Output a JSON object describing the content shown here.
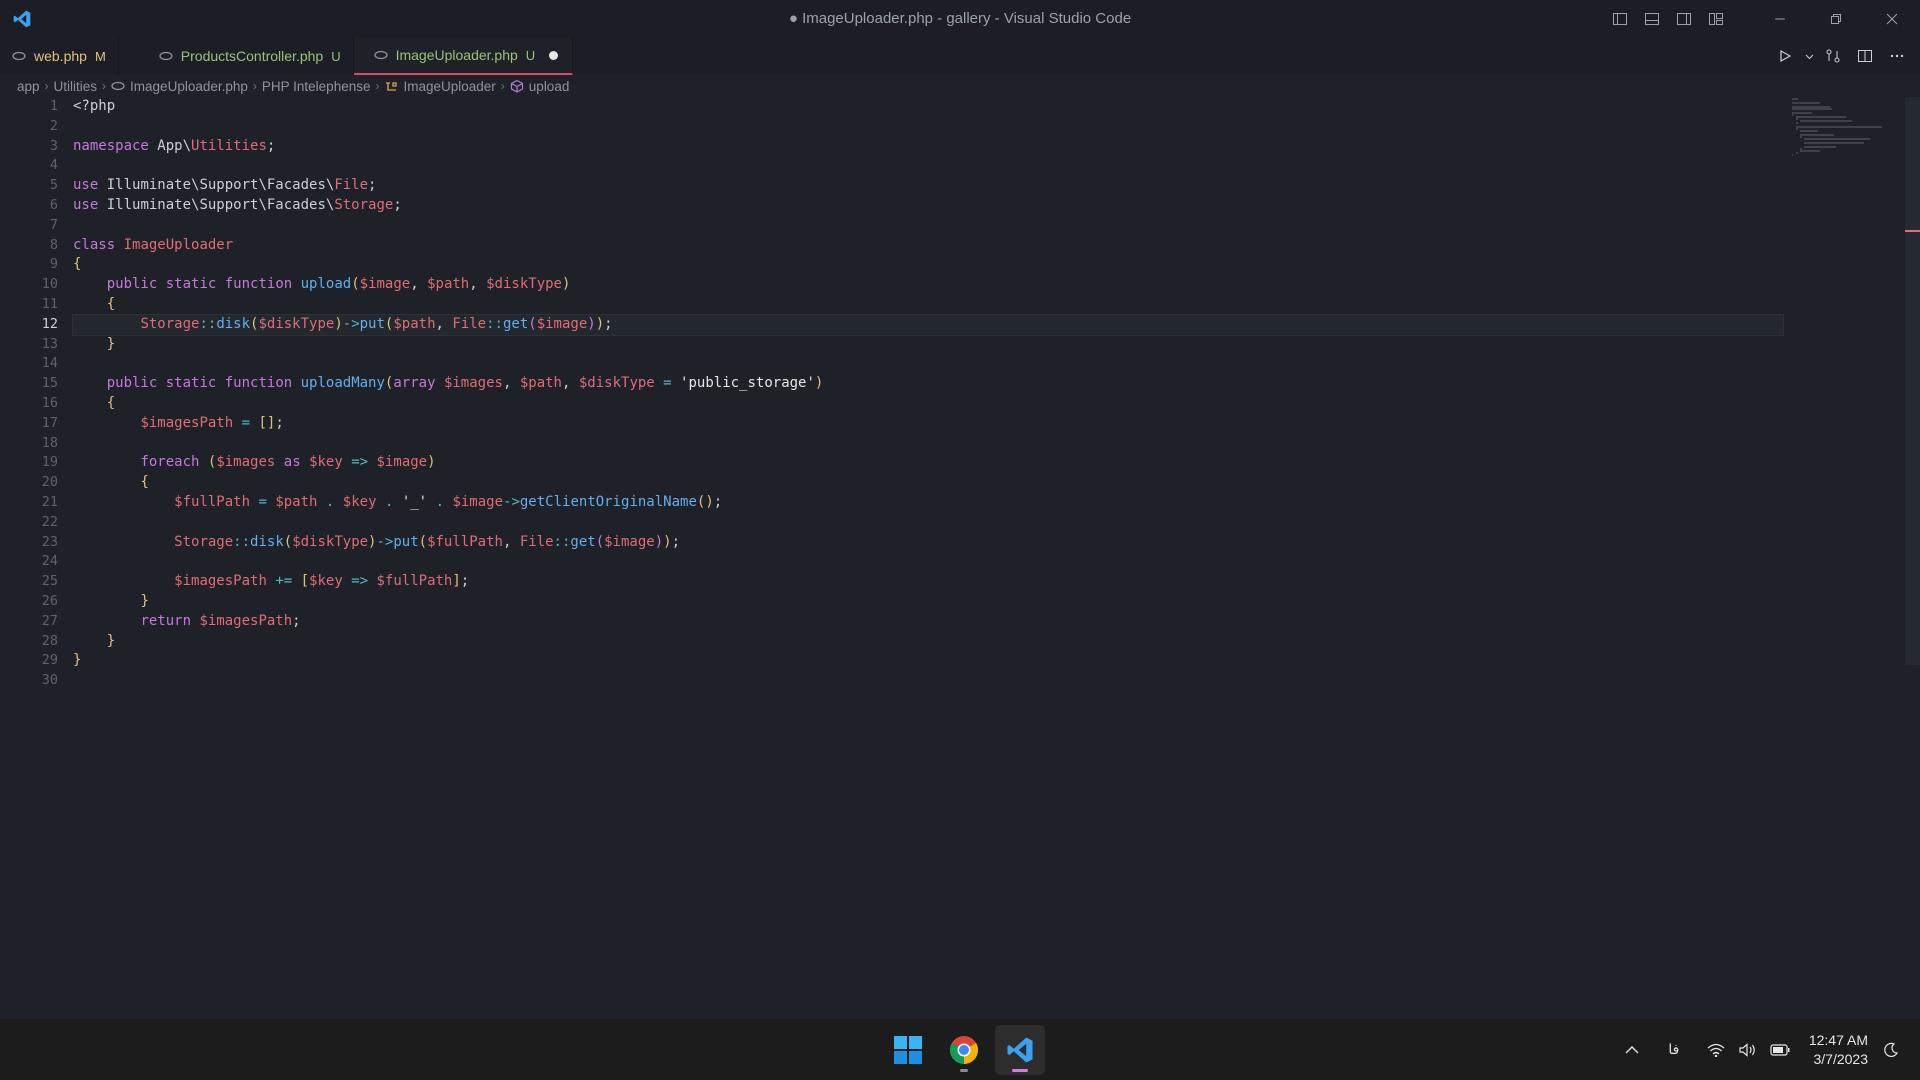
{
  "window": {
    "title": "● ImageUploader.php - gallery - Visual Studio Code"
  },
  "tabs": [
    {
      "label": "web.php",
      "status": "M",
      "state": "modified"
    },
    {
      "label": "ProductsController.php",
      "status": "U",
      "state": "untracked"
    },
    {
      "label": "ImageUploader.php",
      "status": "U",
      "state": "untracked",
      "active": true,
      "dirty": true
    }
  ],
  "breadcrumb": [
    "app",
    "Utilities",
    "ImageUploader.php",
    "PHP Intelephense",
    "ImageUploader",
    "upload"
  ],
  "editor": {
    "current_line": 12,
    "line_numbers": [
      "1",
      "2",
      "3",
      "4",
      "5",
      "6",
      "7",
      "8",
      "9",
      "10",
      "11",
      "12",
      "13",
      "14",
      "15",
      "16",
      "17",
      "18",
      "19",
      "20",
      "21",
      "22",
      "23",
      "24",
      "25",
      "26",
      "27",
      "28",
      "29",
      "30"
    ],
    "lines": [
      "<?php",
      "",
      "namespace App\\Utilities;",
      "",
      "use Illuminate\\Support\\Facades\\File;",
      "use Illuminate\\Support\\Facades\\Storage;",
      "",
      "class ImageUploader",
      "{",
      "    public static function upload($image, $path, $diskType)",
      "    {",
      "        Storage::disk($diskType)->put($path, File::get($image));",
      "    }",
      "",
      "    public static function uploadMany(array $images, $path, $diskType = 'public_storage')",
      "    {",
      "        $imagesPath = [];",
      "",
      "        foreach ($images as $key => $image)",
      "        {",
      "            $fullPath = $path . $key . '_' . $image->getClientOriginalName();",
      "",
      "            Storage::disk($diskType)->put($fullPath, File::get($image));",
      "",
      "            $imagesPath += [$key => $fullPath];",
      "        }",
      "        return $imagesPath;",
      "    }",
      "}",
      ""
    ]
  },
  "taskbar": {
    "apps": [
      "start-icon",
      "chrome-icon",
      "vscode-icon"
    ],
    "tray_lang": "فا",
    "time": "12:47 AM",
    "date": "3/7/2023"
  },
  "colors": {
    "accent": "#e0466b",
    "keyword": "#c678dd",
    "variable": "#e06c75",
    "function": "#61afef"
  }
}
